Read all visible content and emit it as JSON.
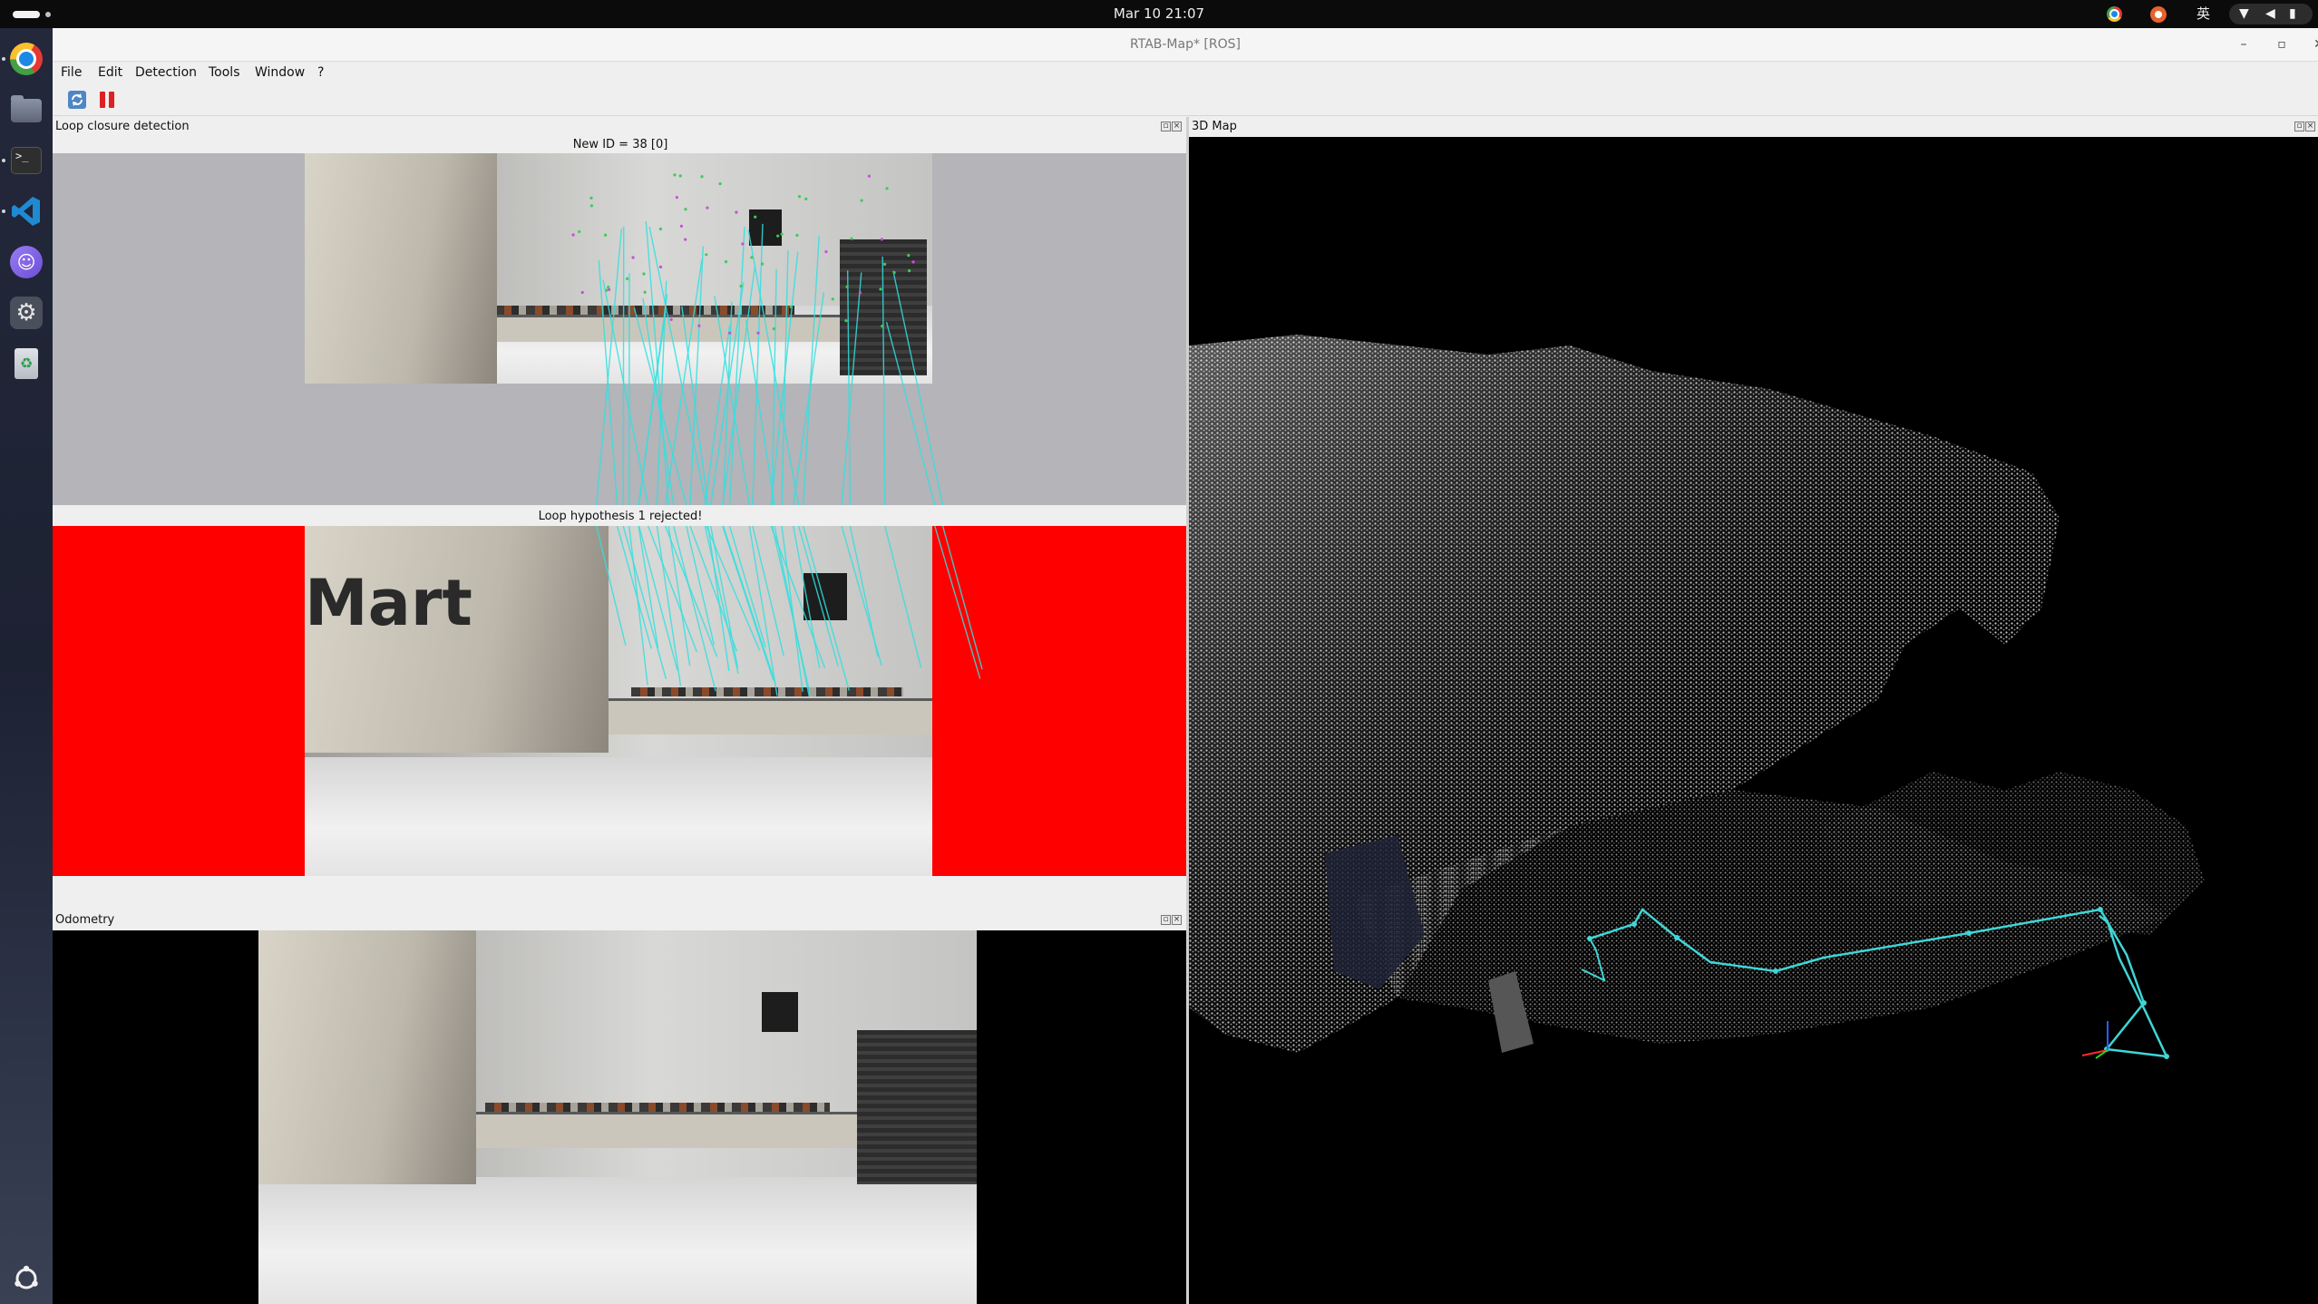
{
  "topbar": {
    "clock": "Mar 10  21:07",
    "ime": "英"
  },
  "dock": {
    "items": [
      "chrome-icon",
      "files-icon",
      "terminal-icon",
      "vscode-icon",
      "cat-app-icon",
      "settings-icon",
      "trash-icon",
      "show-apps-icon"
    ],
    "terminal_glyph": ">_"
  },
  "window": {
    "title": "RTAB-Map* [ROS]",
    "controls": {
      "minimize": "–",
      "maximize": "▫",
      "close": "✕"
    }
  },
  "menu": [
    "File",
    "Edit",
    "Detection",
    "Tools",
    "Window",
    "?"
  ],
  "toolbar": [
    "refresh-icon",
    "pause-icon"
  ],
  "panels": {
    "loop": {
      "title": "Loop closure detection",
      "new_caption": "New ID = 38 [0]",
      "loop_caption": "Loop hypothesis 1 rejected!",
      "loop_background": "#ff0000",
      "new_background": "#b4b4b9"
    },
    "odometry": {
      "title": "Odometry"
    },
    "map": {
      "title": "3D Map"
    }
  },
  "scene_text": {
    "box_label": "Mart"
  },
  "colors": {
    "match_lines": "#33e0e0",
    "trajectory": "#3fd6d6"
  }
}
